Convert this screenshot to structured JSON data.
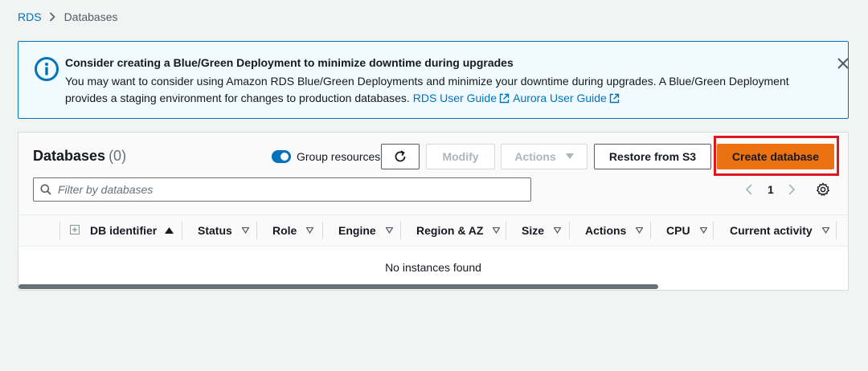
{
  "breadcrumb": {
    "root": "RDS",
    "current": "Databases"
  },
  "banner": {
    "title": "Consider creating a Blue/Green Deployment to minimize downtime during upgrades",
    "body": "You may want to consider using Amazon RDS Blue/Green Deployments and minimize your downtime during upgrades. A Blue/Green Deployment provides a staging environment for changes to production databases.",
    "links": [
      "RDS User Guide",
      "Aurora User Guide"
    ]
  },
  "panel": {
    "title": "Databases",
    "count": "(0)",
    "toggle_label": "Group resources",
    "group_resources_on": true,
    "buttons": {
      "modify": "Modify",
      "actions": "Actions",
      "restore": "Restore from S3",
      "create": "Create database"
    },
    "filter_placeholder": "Filter by databases",
    "page_number": "1",
    "columns": [
      "DB identifier",
      "Status",
      "Role",
      "Engine",
      "Region & AZ",
      "Size",
      "Actions",
      "CPU",
      "Current activity"
    ],
    "sorted_column": "DB identifier",
    "empty_message": "No instances found"
  },
  "colors": {
    "link": "#0073bb",
    "primary_button": "#ec7211",
    "highlight_box": "#e0161d",
    "info_banner_bg": "#f1faff",
    "info_banner_border": "#0073bb"
  },
  "icons": [
    "chevron-right-icon",
    "info-icon",
    "close-icon",
    "external-link-icon",
    "refresh-icon",
    "caret-down-icon",
    "search-icon",
    "chevron-left-icon",
    "settings-icon",
    "expand-icon",
    "sort-ascending-icon",
    "filter-caret-icon"
  ]
}
